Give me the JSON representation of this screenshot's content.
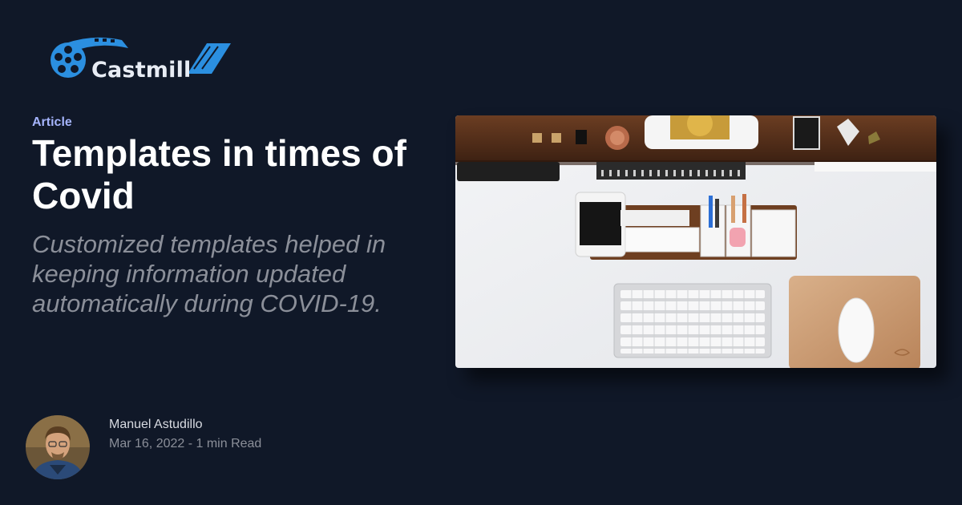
{
  "brand": {
    "name": "Castmill",
    "logo_icon": "film-reel-icon"
  },
  "article": {
    "category": "Article",
    "title": "Templates in times of Covid",
    "subtitle": "Customized templates helped in keeping information updated automatically during COVID-19.",
    "hero_image": "desk-workspace-photo"
  },
  "author": {
    "name": "Manuel Astudillo",
    "date": "Mar 16, 2022",
    "separator": " - ",
    "read_time": "1 min Read"
  },
  "colors": {
    "background": "#101828",
    "accent": "#a5b4fc",
    "brand_blue": "#2b8fe0"
  }
}
